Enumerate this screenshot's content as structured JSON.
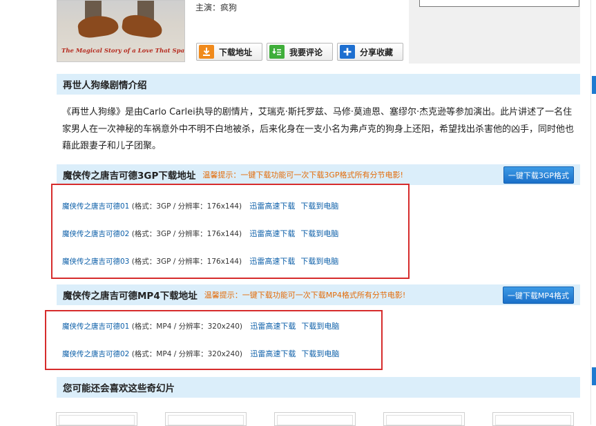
{
  "movie": {
    "poster_tagline": "The Magical Story of a Love That Spans Lifetimes.",
    "starring_label": "主演：",
    "starring_value": "疯狗"
  },
  "actions": {
    "download": "下载地址",
    "comment": "我要评论",
    "share": "分享收藏"
  },
  "plot": {
    "title": "再世人狗缘剧情介绍",
    "text": "《再世人狗缘》是由Carlo Carlei执导的剧情片，艾瑞克·斯托罗兹、马修·莫迪恩、塞缪尔·杰克逊等参加演出。此片讲述了一名住家男人在一次神秘的车祸意外中不明不白地被杀，后来化身在一支小名为弗卢克的狗身上还阳，希望找出杀害他的凶手，同时他也藉此跟妻子和儿子团聚。"
  },
  "sections": [
    {
      "title": "魔侠传之唐吉可德3GP下载地址",
      "tip": "温馨提示：一键下载功能可一次下载3GP格式所有分节电影!",
      "button": "一键下载3GP格式",
      "items": [
        {
          "title": "魔侠传之唐吉可德01",
          "meta": " (格式：3GP / 分辨率：176x144) ",
          "fast": "迅雷高速下载",
          "pc": "下载到电脑"
        },
        {
          "title": "魔侠传之唐吉可德02",
          "meta": " (格式：3GP / 分辨率：176x144) ",
          "fast": "迅雷高速下载",
          "pc": "下载到电脑"
        },
        {
          "title": "魔侠传之唐吉可德03",
          "meta": " (格式：3GP / 分辨率：176x144) ",
          "fast": "迅雷高速下载",
          "pc": "下载到电脑"
        }
      ]
    },
    {
      "title": "魔侠传之唐吉可德MP4下载地址",
      "tip": "温馨提示：一键下载功能可一次下载MP4格式所有分节电影!",
      "button": "一键下载MP4格式",
      "items": [
        {
          "title": "魔侠传之唐吉可德01",
          "meta": " (格式：MP4 / 分辨率：320x240) ",
          "fast": "迅雷高速下载",
          "pc": "下载到电脑"
        },
        {
          "title": "魔侠传之唐吉可德02",
          "meta": " (格式：MP4 / 分辨率：320x240) ",
          "fast": "迅雷高速下载",
          "pc": "下载到电脑"
        }
      ]
    }
  ],
  "related": {
    "title": "您可能还会喜欢这些奇幻片"
  },
  "colors": {
    "header_bg": "#dbeefa",
    "link": "#0b5ea8",
    "tip": "#e36c09",
    "highlight_box": "#d62b2b",
    "button_blue": "#1a6fc9"
  }
}
